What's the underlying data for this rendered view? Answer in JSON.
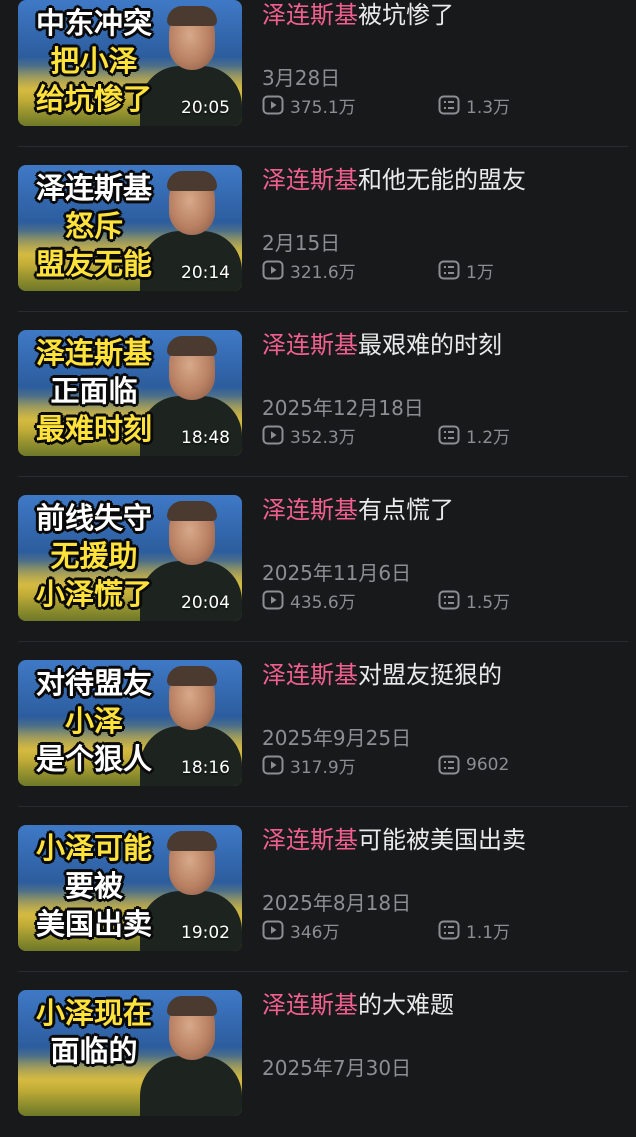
{
  "keyword": "泽连斯基",
  "videos": [
    {
      "caption_lines": [
        "中东冲突",
        "把小泽",
        "给坑惨了"
      ],
      "duration": "20:05",
      "title_rest": "被坑惨了",
      "date": "3月28日",
      "plays": "375.1万",
      "comments": "1.3万"
    },
    {
      "caption_lines": [
        "泽连斯基",
        "怒斥",
        "盟友无能"
      ],
      "duration": "20:14",
      "title_rest": "和他无能的盟友",
      "date": "2月15日",
      "plays": "321.6万",
      "comments": "1万"
    },
    {
      "caption_lines": [
        "泽连斯基",
        "正面临",
        "最难时刻"
      ],
      "duration": "18:48",
      "title_rest": "最艰难的时刻",
      "date": "2025年12月18日",
      "plays": "352.3万",
      "comments": "1.2万"
    },
    {
      "caption_lines": [
        "前线失守",
        "无援助",
        "小泽慌了"
      ],
      "duration": "20:04",
      "title_rest": "有点慌了",
      "date": "2025年11月6日",
      "plays": "435.6万",
      "comments": "1.5万"
    },
    {
      "caption_lines": [
        "对待盟友",
        "小泽",
        "是个狠人"
      ],
      "duration": "18:16",
      "title_rest": "对盟友挺狠的",
      "date": "2025年9月25日",
      "plays": "317.9万",
      "comments": "9602"
    },
    {
      "caption_lines": [
        "小泽可能",
        "要被",
        "美国出卖"
      ],
      "duration": "19:02",
      "title_rest": "可能被美国出卖",
      "date": "2025年8月18日",
      "plays": "346万",
      "comments": "1.1万"
    },
    {
      "caption_lines": [
        "小泽现在",
        "面临的",
        ""
      ],
      "duration": "",
      "title_rest": "的大难题",
      "date": "2025年7月30日",
      "plays": "",
      "comments": ""
    }
  ],
  "icons": {
    "play": "play-count-icon",
    "comment": "danmaku-count-icon"
  },
  "colors": {
    "background": "#18191b",
    "keyword": "#f0608e",
    "caption_highlight": "#ffe23a"
  }
}
